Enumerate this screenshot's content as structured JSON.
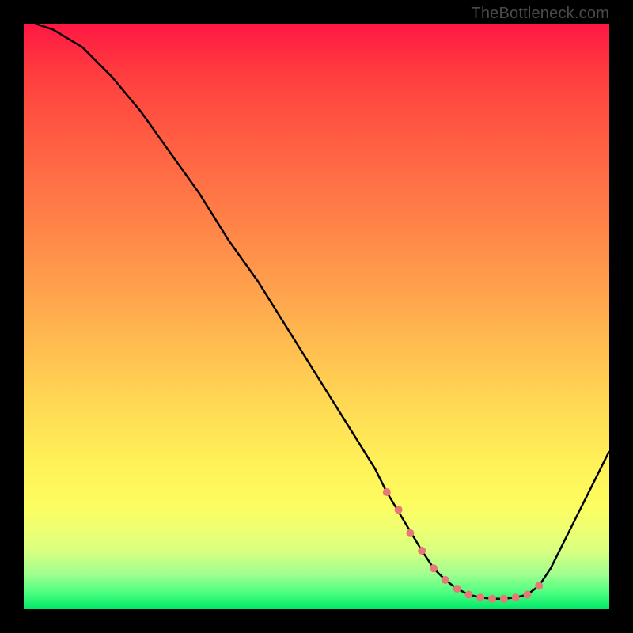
{
  "watermark": "TheBottleneck.com",
  "chart_data": {
    "type": "line",
    "title": "",
    "xlabel": "",
    "ylabel": "",
    "xlim": [
      0,
      100
    ],
    "ylim": [
      0,
      100
    ],
    "gradient_colors": {
      "top": "#ff1744",
      "middle": "#ffd954",
      "bottom": "#00e868"
    },
    "series": [
      {
        "name": "bottleneck-curve",
        "x": [
          2,
          5,
          10,
          15,
          20,
          25,
          30,
          35,
          40,
          45,
          50,
          55,
          60,
          62,
          65,
          68,
          70,
          72,
          74,
          76,
          78,
          80,
          82,
          84,
          86,
          88,
          90,
          92,
          94,
          96,
          98,
          100
        ],
        "y": [
          100,
          99,
          96,
          91,
          85,
          78,
          71,
          63,
          56,
          48,
          40,
          32,
          24,
          20,
          15,
          10,
          7,
          5,
          3.5,
          2.5,
          2,
          1.8,
          1.8,
          2,
          2.5,
          4,
          7,
          11,
          15,
          19,
          23,
          27
        ],
        "color": "#000000"
      }
    ],
    "markers": {
      "name": "highlight-dots",
      "x": [
        62,
        64,
        66,
        68,
        70,
        72,
        74,
        76,
        78,
        80,
        82,
        84,
        86,
        88
      ],
      "y": [
        20,
        17,
        13,
        10,
        7,
        5,
        3.5,
        2.5,
        2,
        1.8,
        1.8,
        2,
        2.5,
        4
      ],
      "color": "#e87878"
    }
  }
}
